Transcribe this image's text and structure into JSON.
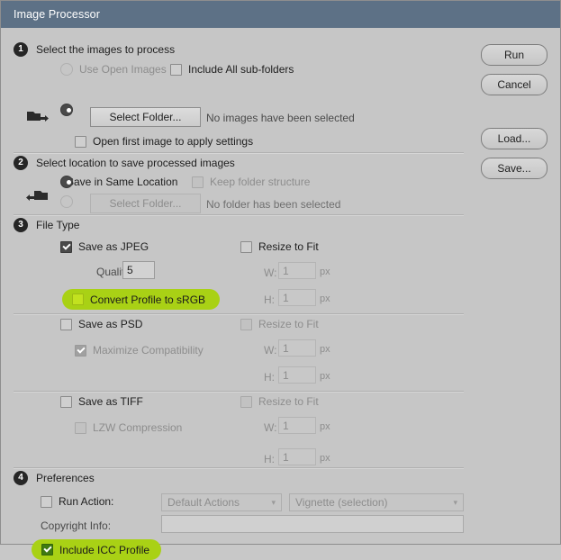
{
  "window": {
    "title": "Image Processor"
  },
  "sections": {
    "one": {
      "number": "1",
      "title": "Select the images to process",
      "use_open_images": "Use Open Images",
      "include_subfolders": "Include All sub-folders",
      "select_folder_button": "Select Folder...",
      "no_images_status": "No images have been selected",
      "open_first_image": "Open first image to apply settings"
    },
    "two": {
      "number": "2",
      "title": "Select location to save processed images",
      "save_same_location": "Save in Same Location",
      "keep_folder_structure": "Keep folder structure",
      "select_folder_button": "Select Folder...",
      "no_folder_status": "No folder has been selected"
    },
    "three": {
      "number": "3",
      "title": "File Type",
      "save_as_jpeg": "Save as JPEG",
      "quality_label": "Quality:",
      "quality_value": "5",
      "convert_srgb": "Convert Profile to sRGB",
      "save_as_psd": "Save as PSD",
      "maximize_compatibility": "Maximize Compatibility",
      "save_as_tiff": "Save as TIFF",
      "lzw_compression": "LZW Compression",
      "resize_to_fit": "Resize to Fit",
      "w_label": "W:",
      "h_label": "H:",
      "unit": "px",
      "jpeg_w": "1",
      "jpeg_h": "1",
      "psd_w": "1",
      "psd_h": "1",
      "tiff_w": "1",
      "tiff_h": "1"
    },
    "four": {
      "number": "4",
      "title": "Preferences",
      "run_action": "Run Action:",
      "action_set_value": "Default Actions",
      "action_value": "Vignette (selection)",
      "copyright_label": "Copyright Info:",
      "copyright_value": "",
      "include_icc": "Include ICC Profile"
    }
  },
  "buttons": {
    "run": "Run",
    "cancel": "Cancel",
    "load": "Load...",
    "save": "Save..."
  },
  "colors": {
    "titlebar": "#5d7186",
    "highlight": "#a9d115",
    "checkbox_green": "#c2e21f",
    "checkbox_checked_green": "#3f7a12"
  }
}
